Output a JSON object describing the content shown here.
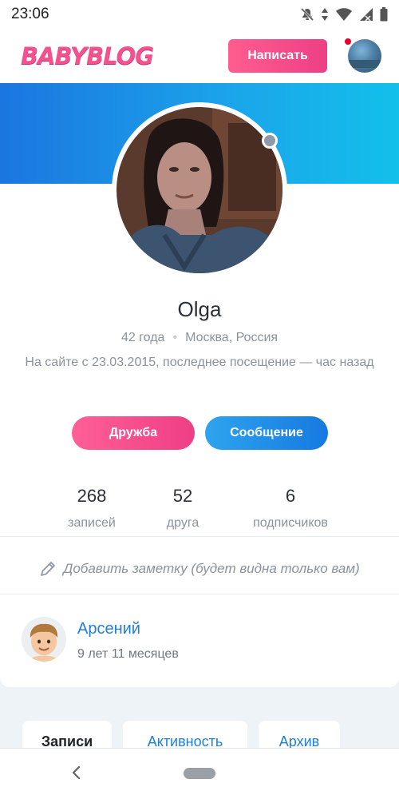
{
  "status_bar": {
    "time": "23:06",
    "icons": [
      "mute-icon",
      "data-transfer-icon",
      "wifi-icon",
      "cellular-signal-icon",
      "battery-icon"
    ]
  },
  "header": {
    "logo_text": "BABYBLOG",
    "write_button": "Написать"
  },
  "profile": {
    "name": "Olga",
    "age": "42 года",
    "location": "Москва, Россия",
    "last_seen": "На сайте с 23.03.2015, последнее посещение — час назад",
    "online_status": "offline",
    "buttons": {
      "friend": "Дружба",
      "message": "Сообщение"
    },
    "stats": [
      {
        "value": "268",
        "label": "записей"
      },
      {
        "value": "52",
        "label": "друга"
      },
      {
        "value": "6",
        "label": "подписчиков"
      }
    ],
    "note_prompt": "Добавить заметку (будет видна только вам)",
    "child": {
      "name": "Арсений",
      "age": "9 лет 11 месяцев"
    }
  },
  "tabs": [
    {
      "label": "Записи",
      "active": true
    },
    {
      "label": "Активность",
      "active": false
    },
    {
      "label": "Архив",
      "active": false
    }
  ],
  "colors": {
    "brand_pink": "#f2538f",
    "brand_blue": "#1d7fd8",
    "cover_gradient_start": "#1b76e0",
    "cover_gradient_end": "#12c0ea",
    "notification": "#e8002a"
  }
}
